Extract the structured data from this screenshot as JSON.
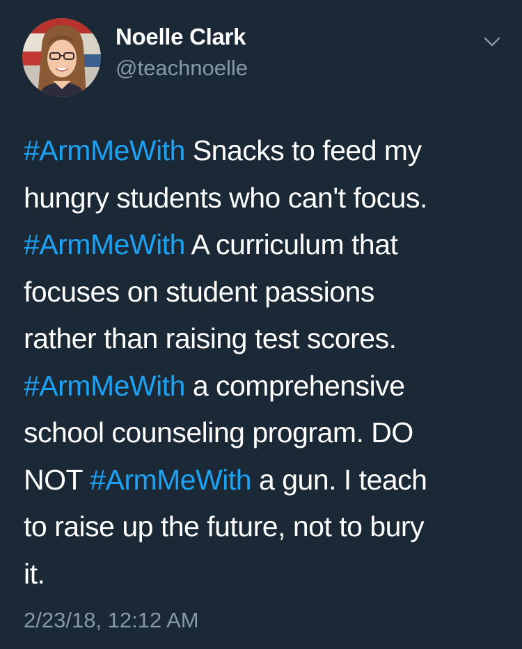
{
  "author": {
    "display_name": "Noelle Clark",
    "handle": "@teachnoelle",
    "avatar_icon": "profile-photo"
  },
  "menu": {
    "icon": "chevron-down-icon"
  },
  "tweet": {
    "lines": [
      {
        "hashtag": "#ArmMeWith",
        "after": " Snacks to feed my"
      },
      {
        "text": "hungry students who can't focus."
      },
      {
        "hashtag": "#ArmMeWith",
        "after": " A curriculum that"
      },
      {
        "text": "focuses on student passions"
      },
      {
        "text": "rather than raising test scores."
      },
      {
        "hashtag": "#ArmMeWith",
        "after": " a comprehensive"
      },
      {
        "text": "school counseling program. DO"
      },
      {
        "before": "NOT ",
        "hashtag": "#ArmMeWith",
        "after": " a gun. I teach"
      },
      {
        "text": "to raise up the future, not to bury"
      },
      {
        "text": "it."
      }
    ],
    "timestamp": "2/23/18, 12:12 AM"
  },
  "colors": {
    "background": "#1b2836",
    "text": "#ffffff",
    "secondary": "#8899a6",
    "link": "#1da1f2"
  }
}
